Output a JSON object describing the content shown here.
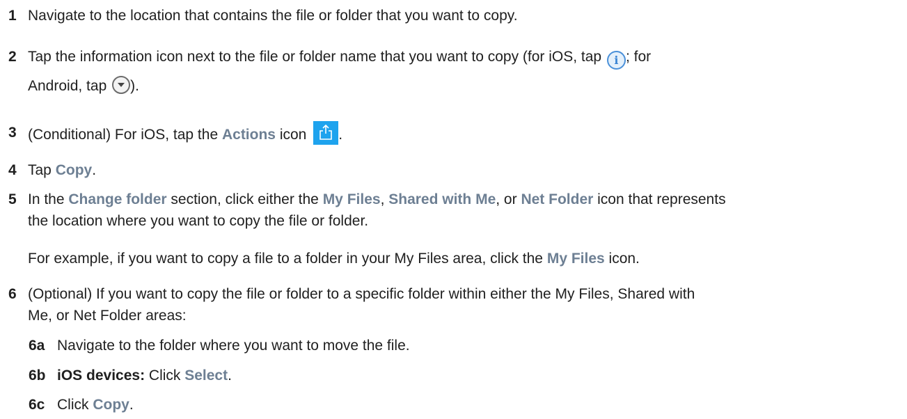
{
  "steps": [
    {
      "num": "1",
      "text": "Navigate to the location that contains the file or folder that you want to copy."
    },
    {
      "num": "2",
      "text_a": "Tap the information icon next to the file or folder name that you want to copy (for iOS, tap ",
      "icon_a": "info-icon",
      "text_b": "; for",
      "text_c": "Android, tap ",
      "icon_b": "chevron-down-circle-icon",
      "text_d": ")."
    },
    {
      "num": "3",
      "text_a": "(Conditional) For iOS, tap the ",
      "ui_a": "Actions",
      "text_b": " icon ",
      "icon": "share-icon",
      "text_c": "."
    },
    {
      "num": "4",
      "text_a": "Tap ",
      "ui_a": "Copy",
      "text_b": "."
    },
    {
      "num": "5",
      "text_a": "In the ",
      "ui_a": "Change folder",
      "text_b": " section, click either the ",
      "ui_b": "My Files",
      "text_c": ", ",
      "ui_c": "Shared with Me",
      "text_d": ", or ",
      "ui_d": "Net Folder",
      "text_e": " icon that represents",
      "text_f": "the location where you want to copy the file or folder."
    },
    {
      "example_a": "For example, if you want to copy a file to a folder in your My Files area, click the ",
      "ui_a": "My Files",
      "example_b": " icon."
    },
    {
      "num": "6",
      "text_a": "(Optional) If you want to copy the file or folder to a specific folder within either the My Files, Shared with",
      "text_b": "Me, or Net Folder areas:"
    }
  ],
  "substeps": [
    {
      "num": "6a",
      "text": "Navigate to the folder where you want to move the file."
    },
    {
      "num": "6b",
      "strong": "iOS devices:",
      "text_a": " Click ",
      "ui": "Select",
      "text_b": "."
    },
    {
      "num": "6c",
      "text_a": "Click ",
      "ui": "Copy",
      "text_b": "."
    }
  ]
}
